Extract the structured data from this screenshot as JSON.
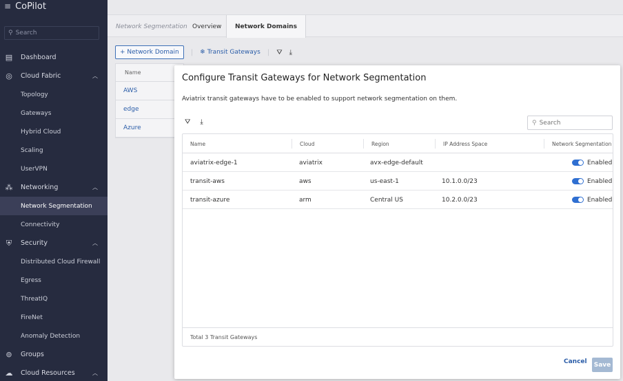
{
  "app": {
    "title": "CoPilot",
    "menu_icon": "collapse-menu-icon"
  },
  "sidebar": {
    "search_placeholder": "Search",
    "items": [
      {
        "label": "Dashboard",
        "icon": "dashboard-icon"
      },
      {
        "label": "Cloud Fabric",
        "icon": "cloud-fabric-icon",
        "expanded": true
      },
      {
        "label": "Topology"
      },
      {
        "label": "Gateways"
      },
      {
        "label": "Hybrid Cloud"
      },
      {
        "label": "Scaling"
      },
      {
        "label": "UserVPN"
      },
      {
        "label": "Networking",
        "icon": "networking-icon",
        "expanded": true
      },
      {
        "label": "Network Segmentation",
        "active": true
      },
      {
        "label": "Connectivity"
      },
      {
        "label": "Security",
        "icon": "security-shield-icon",
        "expanded": true
      },
      {
        "label": "Distributed Cloud Firewall"
      },
      {
        "label": "Egress"
      },
      {
        "label": "ThreatIQ"
      },
      {
        "label": "FireNet"
      },
      {
        "label": "Anomaly Detection"
      },
      {
        "label": "Groups",
        "icon": "groups-icon"
      },
      {
        "label": "Cloud Resources",
        "icon": "cloud-resources-icon",
        "expanded": true
      }
    ]
  },
  "tabs": {
    "breadcrumb": "Network Segmentation",
    "items": [
      "Overview",
      "Network Domains"
    ],
    "active": "Network Domains"
  },
  "toolbar": {
    "add_domain": "+ Network Domain",
    "transit_gateways": "Transit Gateways"
  },
  "domains_table": {
    "header": "Name",
    "rows": [
      "AWS",
      "edge",
      "Azure"
    ]
  },
  "modal": {
    "title": "Configure Transit Gateways for Network Segmentation",
    "description": "Aviatrix transit gateways have to be enabled to support network segmentation on them.",
    "search_placeholder": "Search",
    "columns": [
      "Name",
      "Cloud",
      "Region",
      "IP Address Space",
      "Network Segmentation"
    ],
    "rows": [
      {
        "name": "aviatrix-edge-1",
        "cloud": "aviatrix",
        "region": "avx-edge-default",
        "ip": "",
        "segmentation": "Enabled",
        "enabled": true
      },
      {
        "name": "transit-aws",
        "cloud": "aws",
        "region": "us-east-1",
        "ip": "10.1.0.0/23",
        "segmentation": "Enabled",
        "enabled": true
      },
      {
        "name": "transit-azure",
        "cloud": "arm",
        "region": "Central US",
        "ip": "10.2.0.0/23",
        "segmentation": "Enabled",
        "enabled": true
      }
    ],
    "footer": "Total 3 Transit Gateways",
    "cancel": "Cancel",
    "save": "Save"
  },
  "colors": {
    "sidebar_bg": "#262b3f",
    "active_item": "#3b3f58",
    "accent": "#2b5da8",
    "toggle_on": "#2f6fd1"
  }
}
